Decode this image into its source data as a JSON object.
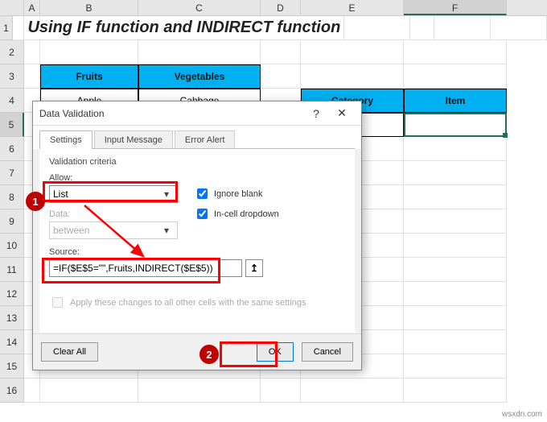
{
  "columns": [
    "A",
    "B",
    "C",
    "D",
    "E",
    "F"
  ],
  "rowCount": 16,
  "title": "Using IF function and INDIRECT function",
  "table1": {
    "headers": [
      "Fruits",
      "Vegetables"
    ],
    "row": [
      "Apple",
      "Cabbage"
    ]
  },
  "table2": {
    "headers": [
      "Category",
      "Item"
    ]
  },
  "dialog": {
    "title": "Data Validation",
    "tabs": [
      "Settings",
      "Input Message",
      "Error Alert"
    ],
    "criteria_label": "Validation criteria",
    "allow_label": "Allow:",
    "allow_value": "List",
    "data_label": "Data:",
    "data_value": "between",
    "ignore_blank": "Ignore blank",
    "incell_dropdown": "In-cell dropdown",
    "source_label": "Source:",
    "source_value": "=IF($E$5=\"\",Fruits,INDIRECT($E$5))",
    "apply_text": "Apply these changes to all other cells with the same settings",
    "clear_all": "Clear All",
    "ok": "OK",
    "cancel": "Cancel"
  },
  "markers": {
    "m1": "1",
    "m2": "2"
  },
  "watermark": "wsxdn.com"
}
